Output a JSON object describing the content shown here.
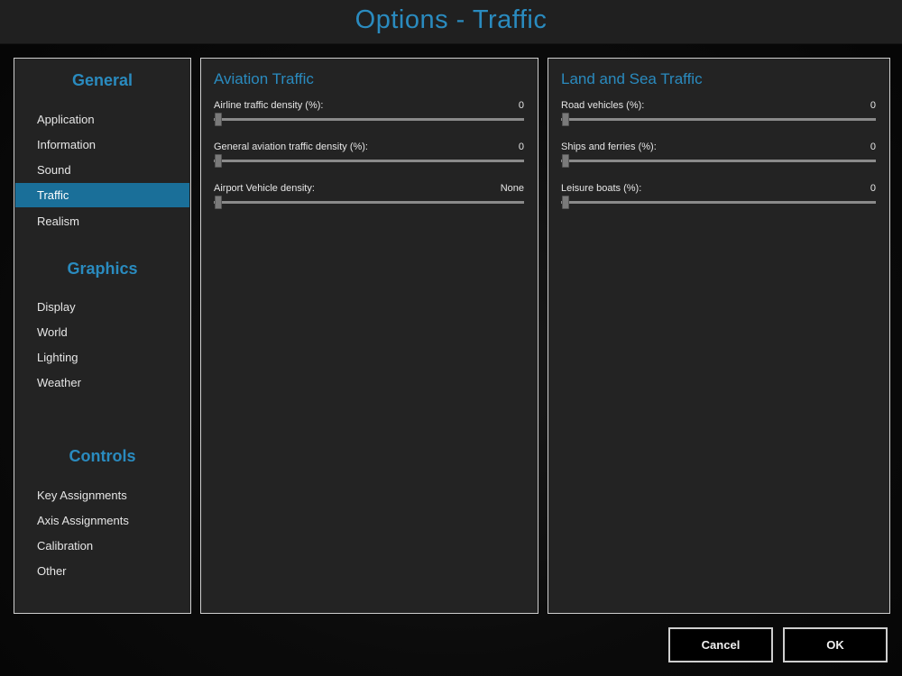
{
  "window": {
    "title": "Options - Traffic"
  },
  "nav": {
    "sections": [
      {
        "header": "General",
        "items": [
          {
            "label": "Application",
            "selected": false
          },
          {
            "label": "Information",
            "selected": false
          },
          {
            "label": "Sound",
            "selected": false
          },
          {
            "label": "Traffic",
            "selected": true
          },
          {
            "label": "Realism",
            "selected": false
          }
        ]
      },
      {
        "header": "Graphics",
        "items": [
          {
            "label": "Display",
            "selected": false
          },
          {
            "label": "World",
            "selected": false
          },
          {
            "label": "Lighting",
            "selected": false
          },
          {
            "label": "Weather",
            "selected": false
          }
        ]
      },
      {
        "header": "Controls",
        "items": [
          {
            "label": "Key Assignments",
            "selected": false
          },
          {
            "label": "Axis Assignments",
            "selected": false
          },
          {
            "label": "Calibration",
            "selected": false
          },
          {
            "label": "Other",
            "selected": false
          }
        ]
      }
    ]
  },
  "aviation": {
    "title": "Aviation Traffic",
    "settings": [
      {
        "label": "Airline traffic density (%):",
        "value": "0",
        "level": 0
      },
      {
        "label": "General aviation traffic density (%):",
        "value": "0",
        "level": 0
      },
      {
        "label": "Airport Vehicle density:",
        "value": "None",
        "level": 0
      }
    ]
  },
  "land_sea": {
    "title": "Land and Sea Traffic",
    "settings": [
      {
        "label": "Road vehicles (%):",
        "value": "0",
        "level": 0
      },
      {
        "label": "Ships and ferries (%):",
        "value": "0",
        "level": 0
      },
      {
        "label": "Leisure boats (%):",
        "value": "0",
        "level": 0
      }
    ]
  },
  "buttons": {
    "cancel": "Cancel",
    "ok": "OK"
  },
  "colors": {
    "accent": "#2a8bbf",
    "selected_bg": "#1a6f99",
    "panel_bg": "#232323",
    "border": "#cfcfcf"
  }
}
